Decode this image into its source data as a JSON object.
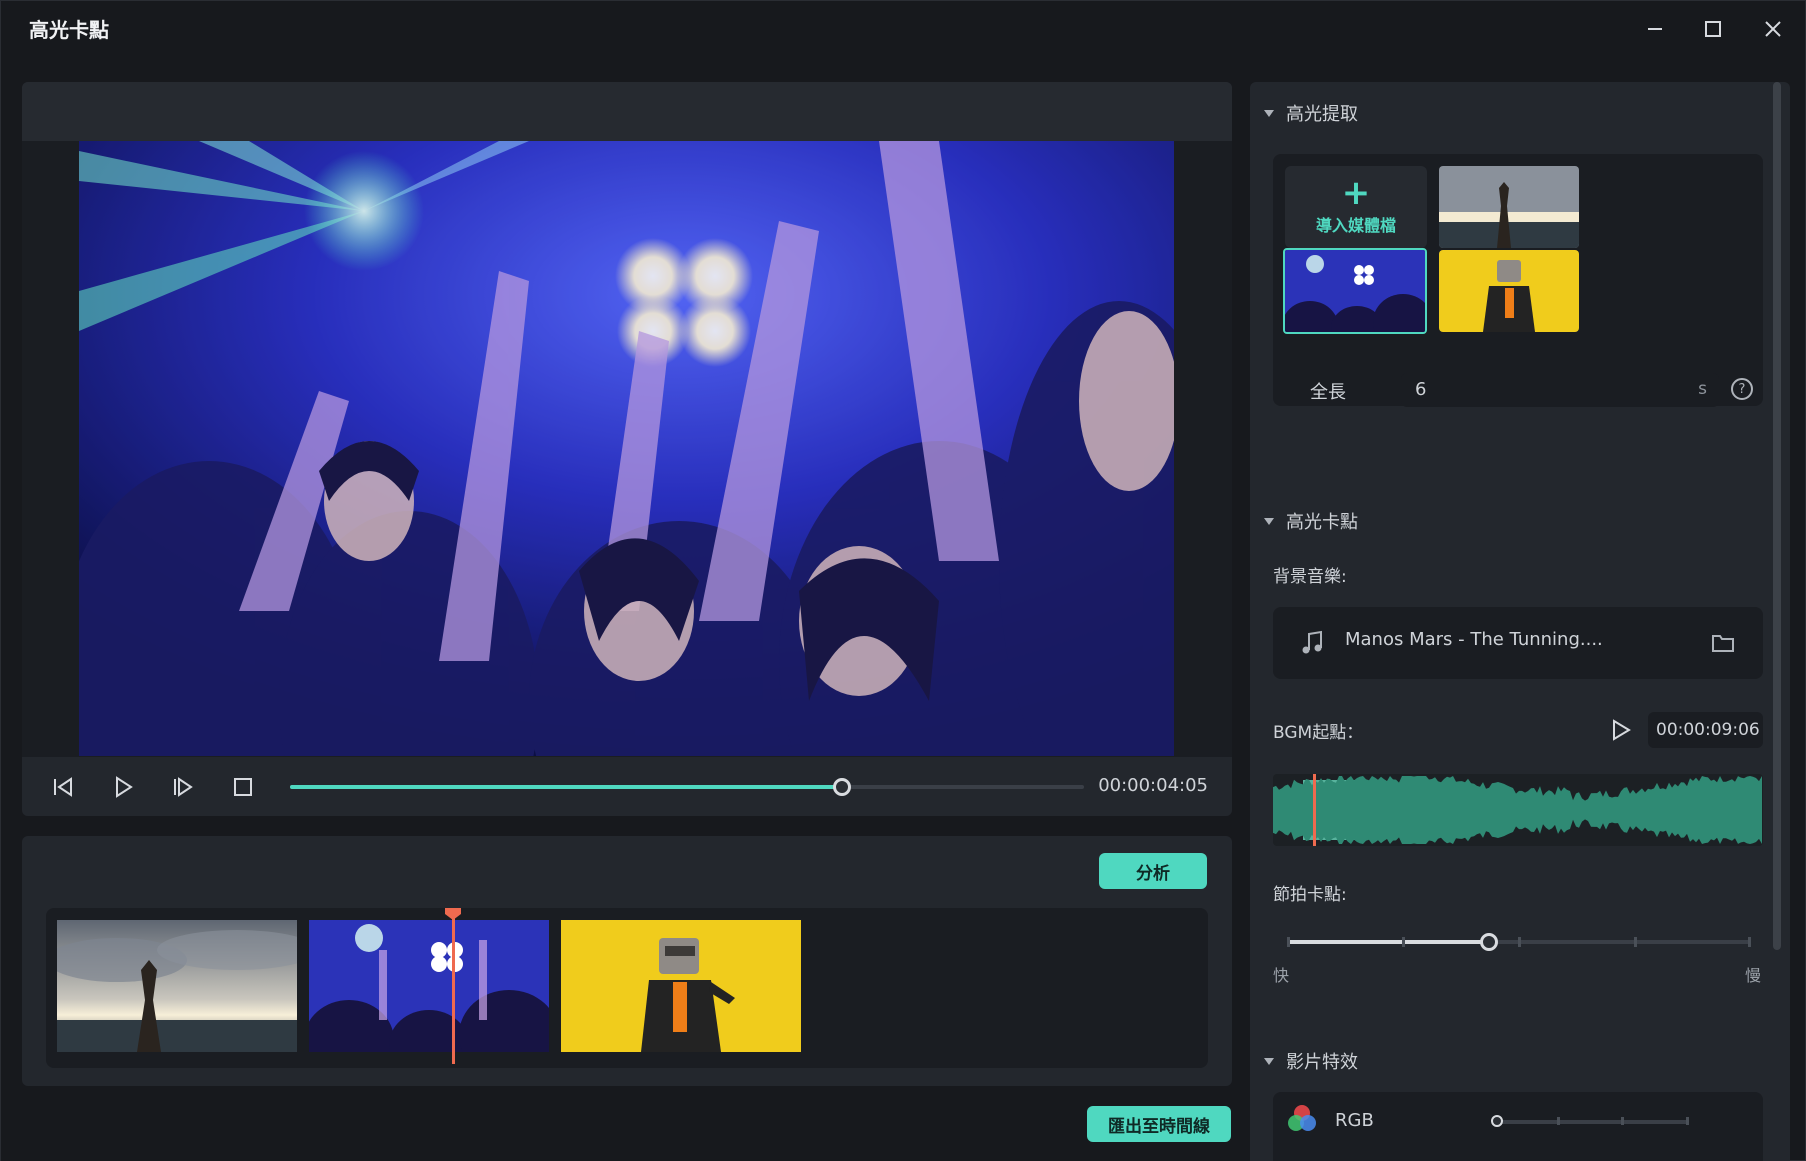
{
  "window": {
    "title": "高光卡點"
  },
  "preview": {
    "timecode": "00:00:04:05",
    "progress": 0.695
  },
  "clips_panel": {
    "analyze_button": "分析",
    "playhead_fraction": 0.6
  },
  "footer": {
    "export_button": "匯出至時間線"
  },
  "right": {
    "highlight_extract": {
      "title": "高光提取",
      "import_label": "導入媒體檔"
    },
    "duration": {
      "label": "全長",
      "value": "6",
      "unit": "s"
    },
    "beat_sync": {
      "title": "高光卡點",
      "bgm_label": "背景音樂:",
      "music_name": "Manos Mars - The Tunning....",
      "bgm_start_label": "BGM起點：",
      "bgm_start_time": "00:00:09:06",
      "beat_label": "節拍卡點:",
      "beat_level": 0.5,
      "fast_label": "快",
      "slow_label": "慢"
    },
    "effects": {
      "title": "影片特效",
      "rgb_label": "RGB",
      "rgb_level": 0
    }
  },
  "colors": {
    "accent": "#4fd8c0",
    "playhead": "#ef6a4f",
    "panel": "#23272d",
    "background": "#17191d"
  }
}
